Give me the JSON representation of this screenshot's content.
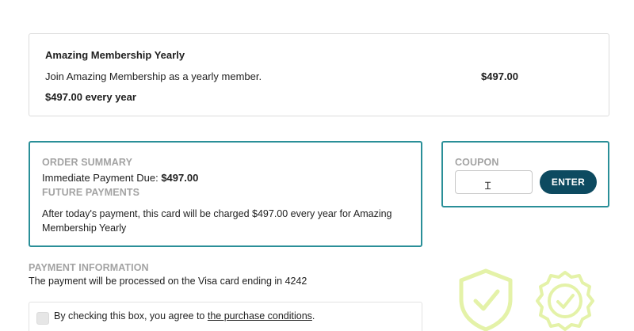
{
  "product": {
    "name": "Amazing Membership Yearly",
    "description": "Join Amazing Membership as a yearly member.",
    "price": "$497.00",
    "recurring": "$497.00 every year"
  },
  "order_summary": {
    "heading": "ORDER SUMMARY",
    "due_label": "Immediate Payment Due:",
    "due_amount": "$497.00",
    "future_heading": "FUTURE PAYMENTS",
    "future_text": "After today's payment, this card will be charged $497.00 every year for Amazing Membership Yearly"
  },
  "coupon": {
    "heading": "COUPON",
    "value": "",
    "button_label": "ENTER"
  },
  "payment": {
    "heading": "PAYMENT INFORMATION",
    "text": "The payment will be processed on the Visa card ending in 4242"
  },
  "terms": {
    "prefix": "By checking this box, you agree to ",
    "link": "the purchase conditions",
    "suffix": "."
  },
  "badges": {
    "color": "#e4f2a8",
    "icons": [
      "shield-check-icon",
      "seal-check-icon"
    ]
  },
  "colors": {
    "accent": "#2a8f98",
    "button": "#0d4a60",
    "muted_heading": "#a3a3a3"
  }
}
